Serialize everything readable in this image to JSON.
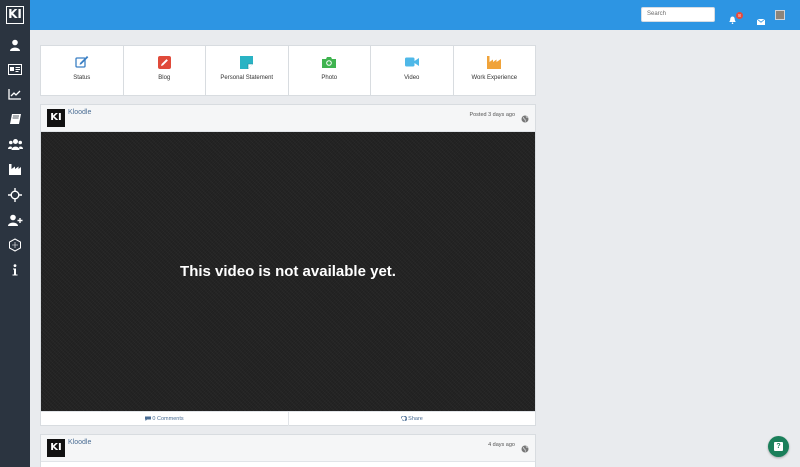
{
  "app": {
    "logo_text": "KI"
  },
  "sidebar": {
    "items": [
      {
        "icon": "user-icon"
      },
      {
        "icon": "id-card-icon"
      },
      {
        "icon": "chart-line-icon"
      },
      {
        "icon": "book-icon"
      },
      {
        "icon": "users-icon"
      },
      {
        "icon": "industry-icon"
      },
      {
        "icon": "crosshair-icon"
      },
      {
        "icon": "user-plus-icon"
      },
      {
        "icon": "hexagon-icon"
      },
      {
        "icon": "info-icon"
      }
    ]
  },
  "topbar": {
    "search_placeholder": "Search",
    "notification_count": "8",
    "color": "#2d95e3"
  },
  "post_types": [
    {
      "label": "Status",
      "icon": "edit-icon",
      "color": "#3a7fc4"
    },
    {
      "label": "Blog",
      "icon": "pencil-icon",
      "color": "#e04a3a"
    },
    {
      "label": "Personal Statement",
      "icon": "sticky-note-icon",
      "color": "#2ab3c4"
    },
    {
      "label": "Photo",
      "icon": "camera-icon",
      "color": "#3fb34f"
    },
    {
      "label": "Video",
      "icon": "video-icon",
      "color": "#4fb8e8"
    },
    {
      "label": "Work Experience",
      "icon": "industry-icon",
      "color": "#f0a33a"
    }
  ],
  "posts": [
    {
      "avatar_text": "KI",
      "author": "Kloodle",
      "time": "Posted 3 days ago",
      "video_message": "This video is not available yet.",
      "comments_label": "0 Comments",
      "share_label": "Share"
    },
    {
      "avatar_text": "KI",
      "author": "Kloodle",
      "time": "4 days ago"
    }
  ],
  "help": {
    "label": "?"
  }
}
